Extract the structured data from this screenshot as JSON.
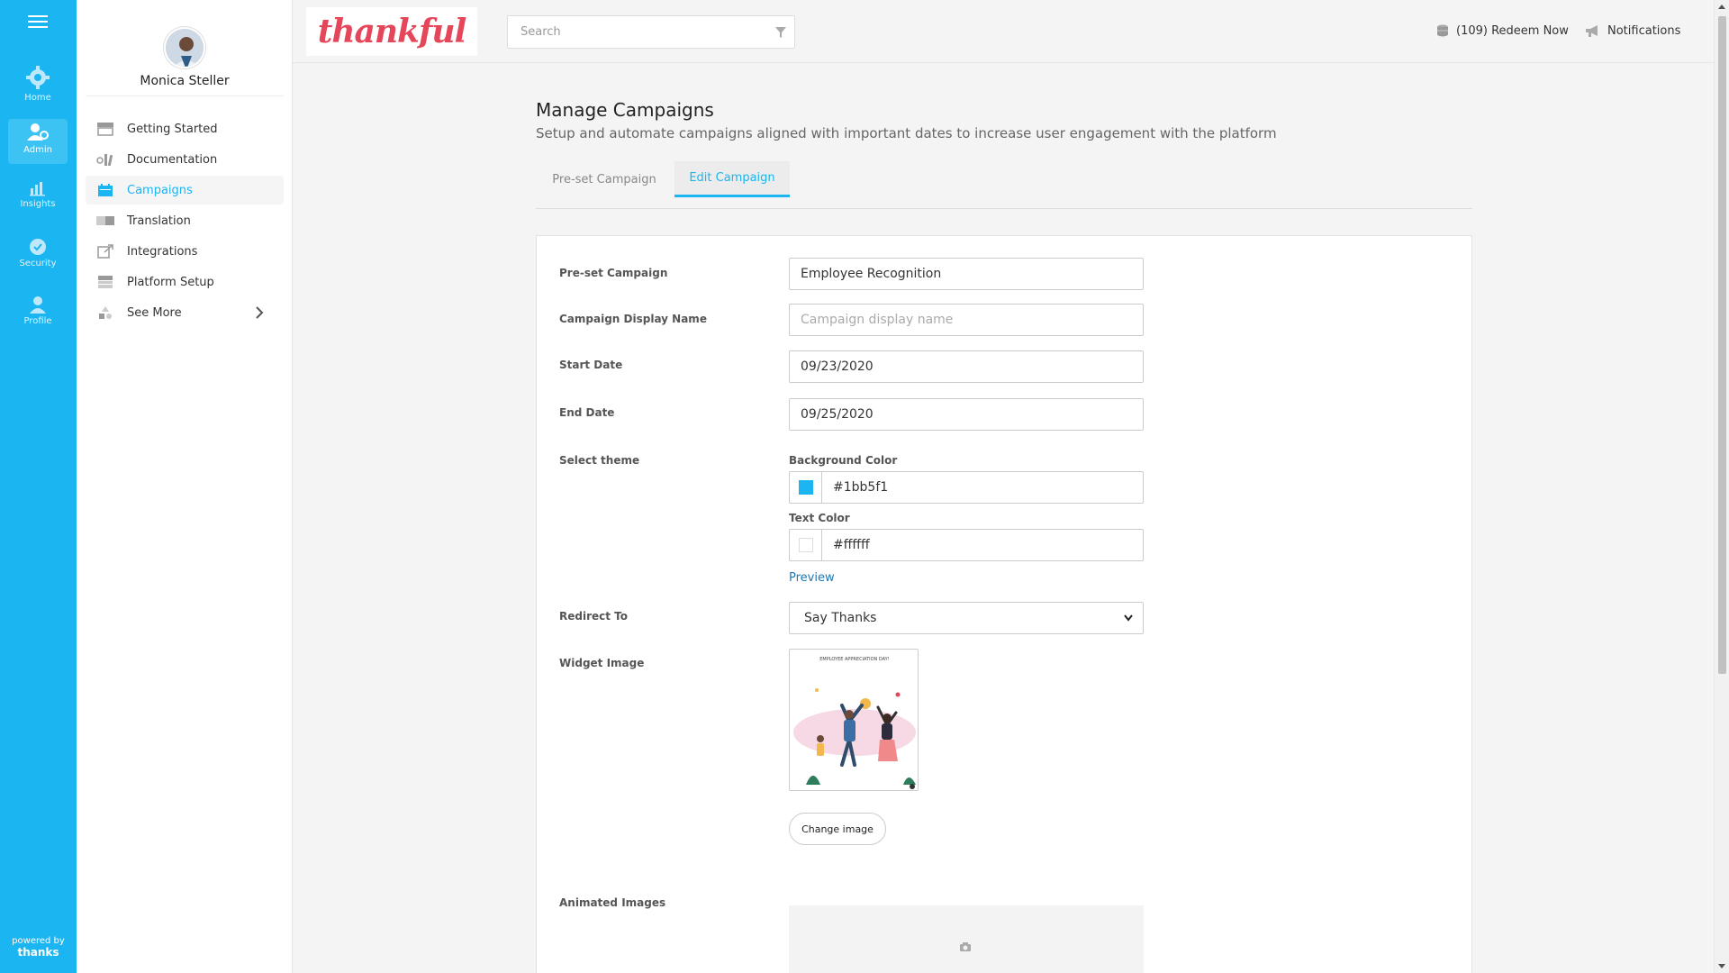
{
  "rail": {
    "items": [
      {
        "label": "Home",
        "icon": "gear-icon"
      },
      {
        "label": "Admin",
        "icon": "admin-user-icon"
      },
      {
        "label": "Insights",
        "icon": "chart-icon"
      },
      {
        "label": "Security",
        "icon": "shield-icon"
      },
      {
        "label": "Profile",
        "icon": "person-icon"
      }
    ],
    "footer": {
      "powered": "powered by",
      "brand": "thanks"
    }
  },
  "sidebar": {
    "user_name": "Monica Steller",
    "items": [
      {
        "label": "Getting Started",
        "icon": "store-icon"
      },
      {
        "label": "Documentation",
        "icon": "document-icon"
      },
      {
        "label": "Campaigns",
        "icon": "calendar-icon"
      },
      {
        "label": "Translation",
        "icon": "translate-icon"
      },
      {
        "label": "Integrations",
        "icon": "link-icon"
      },
      {
        "label": "Platform Setup",
        "icon": "setup-icon"
      },
      {
        "label": "See More",
        "icon": "shapes-icon"
      }
    ]
  },
  "header": {
    "logo_text": "thankful",
    "search_placeholder": "Search",
    "redeem": "(109) Redeem Now",
    "notifications": "Notifications"
  },
  "main": {
    "title": "Manage Campaigns",
    "subtitle": "Setup and automate campaigns aligned with important dates to increase user engagement with the platform",
    "tabs": [
      "Pre-set Campaign",
      "Edit Campaign"
    ],
    "form": {
      "preset_label": "Pre-set Campaign",
      "preset_value": "Employee Recognition",
      "display_name_label": "Campaign Display Name",
      "display_name_placeholder": "Campaign display name",
      "start_label": "Start Date",
      "start_value": "09/23/2020",
      "end_label": "End Date",
      "end_value": "09/25/2020",
      "theme_label": "Select theme",
      "bg_color_label": "Background Color",
      "bg_color_value": "#1bb5f1",
      "text_color_label": "Text Color",
      "text_color_value": "#ffffff",
      "preview": "Preview",
      "redirect_label": "Redirect To",
      "redirect_value": "Say Thanks",
      "widget_label": "Widget Image",
      "widget_caption": "EMPLOYEE APPRECIATION DAY!",
      "change_image": "Change image",
      "animated_label": "Animated Images"
    }
  },
  "colors": {
    "accent": "#1bb5f1",
    "logo": "#e5465a"
  }
}
